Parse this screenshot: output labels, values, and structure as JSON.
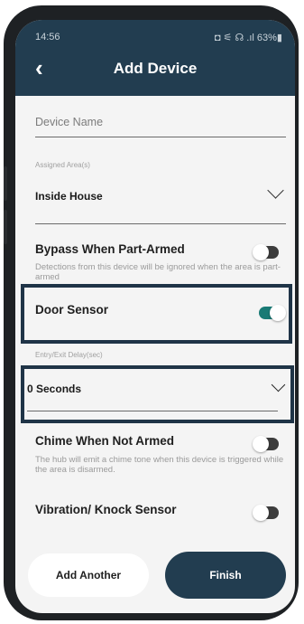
{
  "status_bar": {
    "time": "14:56",
    "indicators": "◘ ⚟ ☊ .ıl 63%▮"
  },
  "header": {
    "title": "Add Device",
    "back_icon": "‹"
  },
  "device_name": {
    "placeholder": "Device Name"
  },
  "assigned_area": {
    "label": "Assigned Area(s)",
    "value": "Inside House"
  },
  "bypass": {
    "label": "Bypass When Part-Armed",
    "description": "Detections from this device will be ignored when the area is part-armed",
    "enabled": false
  },
  "door_sensor": {
    "label": "Door Sensor",
    "enabled": true
  },
  "entry_exit_delay": {
    "label": "Entry/Exit Delay(sec)",
    "value": "0 Seconds"
  },
  "chime": {
    "label": "Chime When Not Armed",
    "description": "The hub will emit a chime tone when this device is triggered while the area is disarmed.",
    "enabled": false
  },
  "vibration": {
    "label": "Vibration/ Knock Sensor",
    "enabled": false
  },
  "buttons": {
    "add_another": "Add Another",
    "finish": "Finish"
  },
  "colors": {
    "header": "#223d50",
    "toggle_on": "#197a75",
    "highlight": "#1f3447"
  }
}
